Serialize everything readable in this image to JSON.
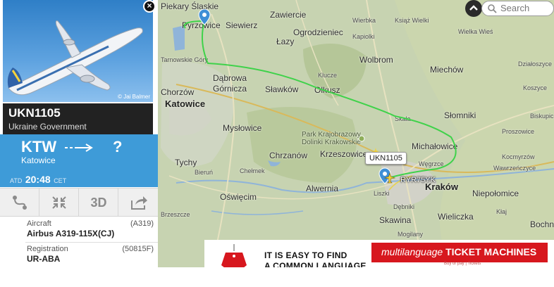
{
  "search": {
    "placeholder": "Search"
  },
  "map": {
    "towns": [
      {
        "name": "Pyrzowice"
      },
      {
        "name": "Siewierz"
      },
      {
        "name": "Zawiercie"
      },
      {
        "name": "Ogrodzieniec"
      },
      {
        "name": "Łazy"
      },
      {
        "name": "Kapiolki"
      },
      {
        "name": "Wierbka"
      },
      {
        "name": "Książ Wielki"
      },
      {
        "name": "Wolbrom"
      },
      {
        "name": "Wielka Wieś"
      },
      {
        "name": "Miechów"
      },
      {
        "name": "Działoszyce"
      },
      {
        "name": "Dąbrowa Górnicza"
      },
      {
        "name": "Sławków"
      },
      {
        "name": "Olkusz"
      },
      {
        "name": "Klucze"
      },
      {
        "name": "Katowice"
      },
      {
        "name": "Mysłowice"
      },
      {
        "name": "Chorzów"
      },
      {
        "name": "Słomniki"
      },
      {
        "name": "Michałowice"
      },
      {
        "name": "Proszowice"
      },
      {
        "name": "Skała"
      },
      {
        "name": "Chrzanów"
      },
      {
        "name": "Krzeszowice"
      },
      {
        "name": "Tychy"
      },
      {
        "name": "Chełmek"
      },
      {
        "name": "Bieruń"
      },
      {
        "name": "Alwernia"
      },
      {
        "name": "Kraków"
      },
      {
        "name": "Liszki"
      },
      {
        "name": "Węgrzce"
      },
      {
        "name": "Oświęcim"
      },
      {
        "name": "Niepołomice"
      },
      {
        "name": "Skawina"
      },
      {
        "name": "Wieliczka"
      },
      {
        "name": "Mogilany"
      },
      {
        "name": "Kocmyrzów"
      },
      {
        "name": "Wawrzeńczyce"
      },
      {
        "name": "Kłaj"
      },
      {
        "name": "Bochnia"
      },
      {
        "name": "Koszyce"
      },
      {
        "name": "Biskupice"
      },
      {
        "name": "Brzeszcze"
      },
      {
        "name": "Piekary Śląskie"
      },
      {
        "name": "Tarnowskie Góry"
      },
      {
        "name": "Dębniki"
      }
    ],
    "park_label": "Park Krajobrazowy Dolinki Krakowskie",
    "selected_flight_tag": "UKN1105",
    "other_flight_tag": "RYR75YK",
    "route_color": "#3fd24a"
  },
  "panel": {
    "photo_credit": "© Jai Balmer",
    "callsign": "UKN1105",
    "airline": "Ukraine Government",
    "from_code": "KTW",
    "from_city": "Katowice",
    "to_code": "?",
    "atd_label": "ATD",
    "atd_time": "20:48",
    "atd_tz": "CET",
    "actions": [
      {
        "icon": "route-icon"
      },
      {
        "icon": "center-icon"
      },
      {
        "label": "3D"
      },
      {
        "icon": "share-icon"
      }
    ],
    "aircraft_label": "Aircraft",
    "aircraft_code": "(A319)",
    "aircraft_value": "Airbus A319-115X(CJ)",
    "registration_label": "Registration",
    "registration_code": "(50815F)",
    "registration_value": "UR-ABA",
    "accent_color": "#3e9bd8"
  },
  "ad": {
    "line1": "IT IS EASY TO FIND",
    "line2": "A COMMON LANGUAGE",
    "brand_italic": "multilanguage",
    "brand_bold": "TICKET MACHINES",
    "sub": "Buy or pay | Tickets"
  }
}
